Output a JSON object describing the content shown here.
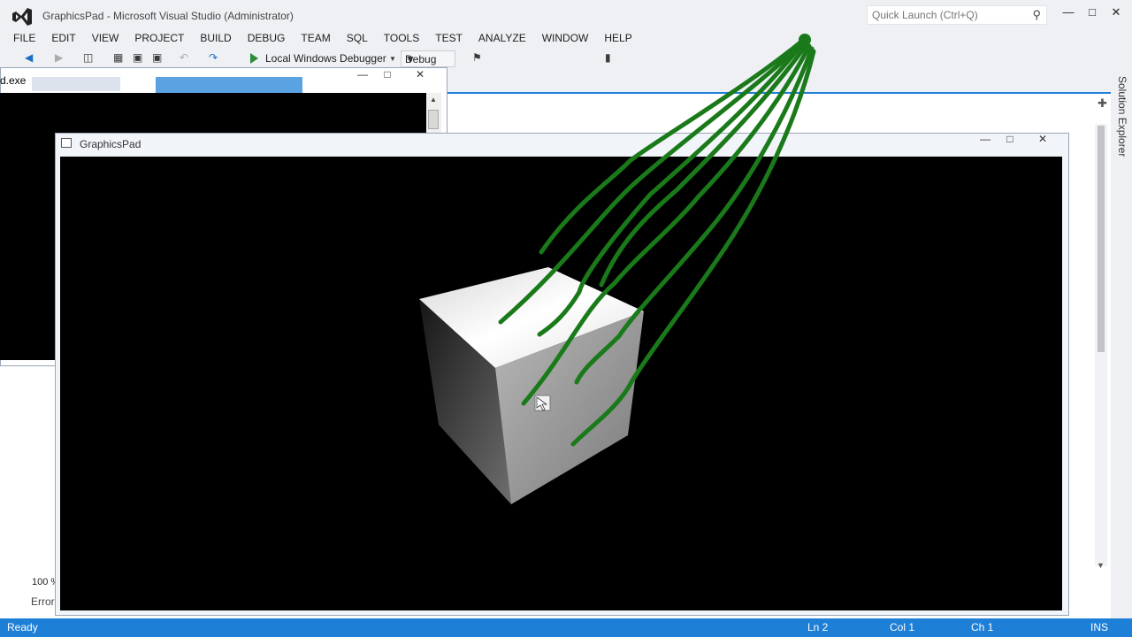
{
  "window": {
    "title": "GraphicsPad - Microsoft Visual Studio (Administrator)",
    "quick_launch_placeholder": "Quick Launch (Ctrl+Q)"
  },
  "menu": [
    "FILE",
    "EDIT",
    "VIEW",
    "PROJECT",
    "BUILD",
    "DEBUG",
    "TEAM",
    "SQL",
    "TOOLS",
    "TEST",
    "ANALYZE",
    "WINDOW",
    "HELP"
  ],
  "toolbar": {
    "debugger_label": "Local Windows Debugger",
    "configuration": "Debug"
  },
  "side_panel": {
    "label": "Solution Explorer"
  },
  "editor": {
    "zoom": "100 %",
    "error_tab": "Error"
  },
  "console_window": {
    "title": "d.exe"
  },
  "graphics_window": {
    "title": "GraphicsPad"
  },
  "statusbar": {
    "ready": "Ready",
    "line": "Ln 2",
    "col": "Col 1",
    "ch": "Ch 1",
    "mode": "INS"
  },
  "colors": {
    "accent": "#1e7fd6",
    "annotation": "#1a7a1a",
    "canvas": "#000000"
  },
  "icons": [
    "visual-studio-logo-icon",
    "search-icon",
    "minimize-icon",
    "maximize-icon",
    "close-icon",
    "back-icon",
    "forward-icon",
    "new-project-icon",
    "open-file-icon",
    "save-icon",
    "save-all-icon",
    "undo-icon",
    "redo-icon",
    "start-debug-icon",
    "find-icon",
    "bookmark-icon",
    "pin-icon",
    "app-window-icon",
    "mouse-cursor-icon"
  ]
}
